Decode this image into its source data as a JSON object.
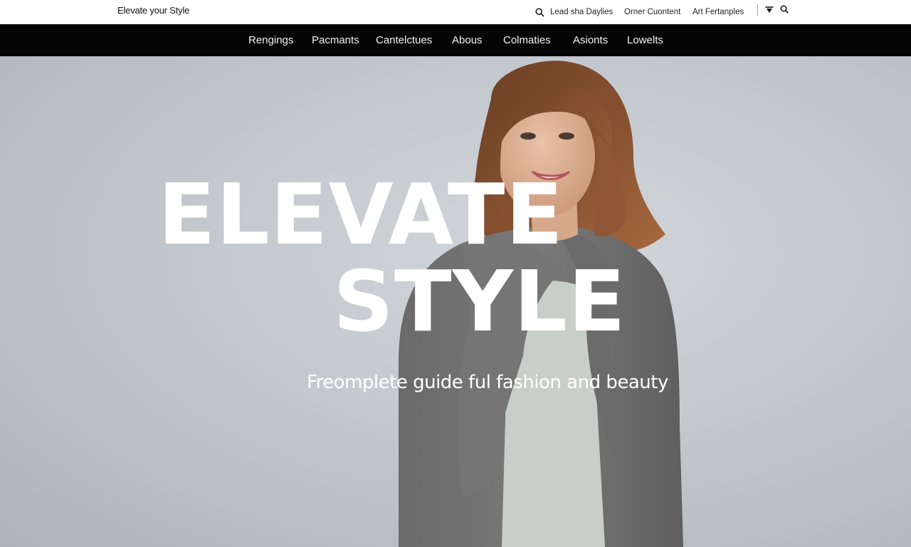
{
  "header": {
    "brand": "Elevate your Style",
    "utility_links": [
      {
        "label": "Lead sha Daylies",
        "icon": "search-icon"
      },
      {
        "label": "Orner Cuontent"
      },
      {
        "label": "Art Fertanples"
      }
    ],
    "utility_icons": [
      "filter-icon",
      "search-icon"
    ]
  },
  "nav": {
    "items": [
      "Rengings",
      "Pacmants",
      "Cantelctues",
      "Abous",
      "Colmaties",
      "Asionts",
      "Lowelts"
    ]
  },
  "hero": {
    "headline_line1": "ELEVATE",
    "headline_line2": "STYLE",
    "subheadline": "Freomplete guide ful fashion and beauty"
  },
  "colors": {
    "nav_background": "#050505",
    "hero_background": "#c4c9cf",
    "headline": "#ffffff"
  }
}
